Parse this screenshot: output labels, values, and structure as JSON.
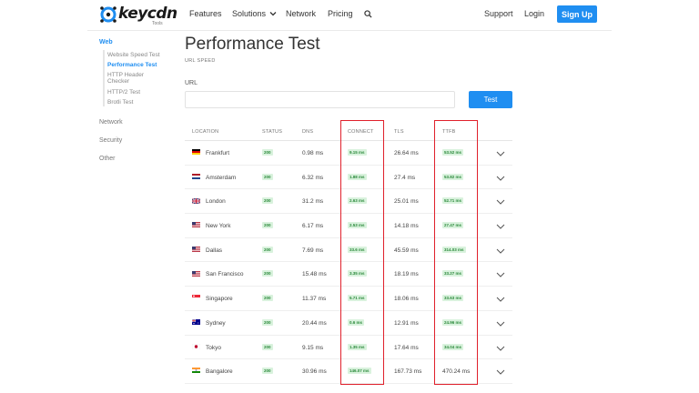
{
  "brand": {
    "name": "keycdn",
    "sub": "Tools",
    "accent": "#1f8ef1"
  },
  "nav": {
    "features": "Features",
    "solutions": "Solutions",
    "network": "Network",
    "pricing": "Pricing",
    "support": "Support",
    "login": "Login",
    "signup": "Sign Up"
  },
  "sidebar": {
    "web": "Web",
    "items": [
      "Website Speed Test",
      "Performance Test",
      "HTTP Header Checker",
      "HTTP/2 Test",
      "Brotli Test"
    ],
    "network": "Network",
    "security": "Security",
    "other": "Other"
  },
  "page": {
    "title": "Performance Test",
    "subtitle": "URL SPEED",
    "url_label": "URL",
    "url_value": "",
    "test_label": "Test"
  },
  "table": {
    "headers": [
      "LOCATION",
      "STATUS",
      "DNS",
      "CONNECT",
      "TLS",
      "TTFB"
    ],
    "rows": [
      {
        "location": "Frankfurt",
        "flag": "de",
        "status": "200",
        "dns": "0.98 ms",
        "connect": "9.15 ms",
        "tls": "26.64 ms",
        "ttfb": "53.52 ms"
      },
      {
        "location": "Amsterdam",
        "flag": "nl",
        "status": "200",
        "dns": "6.32 ms",
        "connect": "1.88 ms",
        "tls": "27.4 ms",
        "ttfb": "53.82 ms"
      },
      {
        "location": "London",
        "flag": "uk",
        "status": "200",
        "dns": "31.2 ms",
        "connect": "2.63 ms",
        "tls": "25.01 ms",
        "ttfb": "52.71 ms"
      },
      {
        "location": "New York",
        "flag": "us",
        "status": "200",
        "dns": "6.17 ms",
        "connect": "2.53 ms",
        "tls": "14.18 ms",
        "ttfb": "27.47 ms"
      },
      {
        "location": "Dallas",
        "flag": "us",
        "status": "200",
        "dns": "7.69 ms",
        "connect": "33.6 ms",
        "tls": "45.59 ms",
        "ttfb": "314.03 ms"
      },
      {
        "location": "San Francisco",
        "flag": "us",
        "status": "200",
        "dns": "15.48 ms",
        "connect": "3.35 ms",
        "tls": "18.19 ms",
        "ttfb": "33.27 ms"
      },
      {
        "location": "Singapore",
        "flag": "sg",
        "status": "200",
        "dns": "11.37 ms",
        "connect": "5.71 ms",
        "tls": "18.06 ms",
        "ttfb": "33.63 ms"
      },
      {
        "location": "Sydney",
        "flag": "au",
        "status": "200",
        "dns": "20.44 ms",
        "connect": "0.6 ms",
        "tls": "12.91 ms",
        "ttfb": "24.96 ms"
      },
      {
        "location": "Tokyo",
        "flag": "jp",
        "status": "200",
        "dns": "9.15 ms",
        "connect": "1.35 ms",
        "tls": "17.64 ms",
        "ttfb": "34.04 ms"
      },
      {
        "location": "Bangalore",
        "flag": "in",
        "status": "200",
        "dns": "30.96 ms",
        "connect": "146.07 ms",
        "tls": "167.73 ms",
        "ttfb": "470.24 ms"
      }
    ]
  },
  "highlight_color": "#e0202b"
}
